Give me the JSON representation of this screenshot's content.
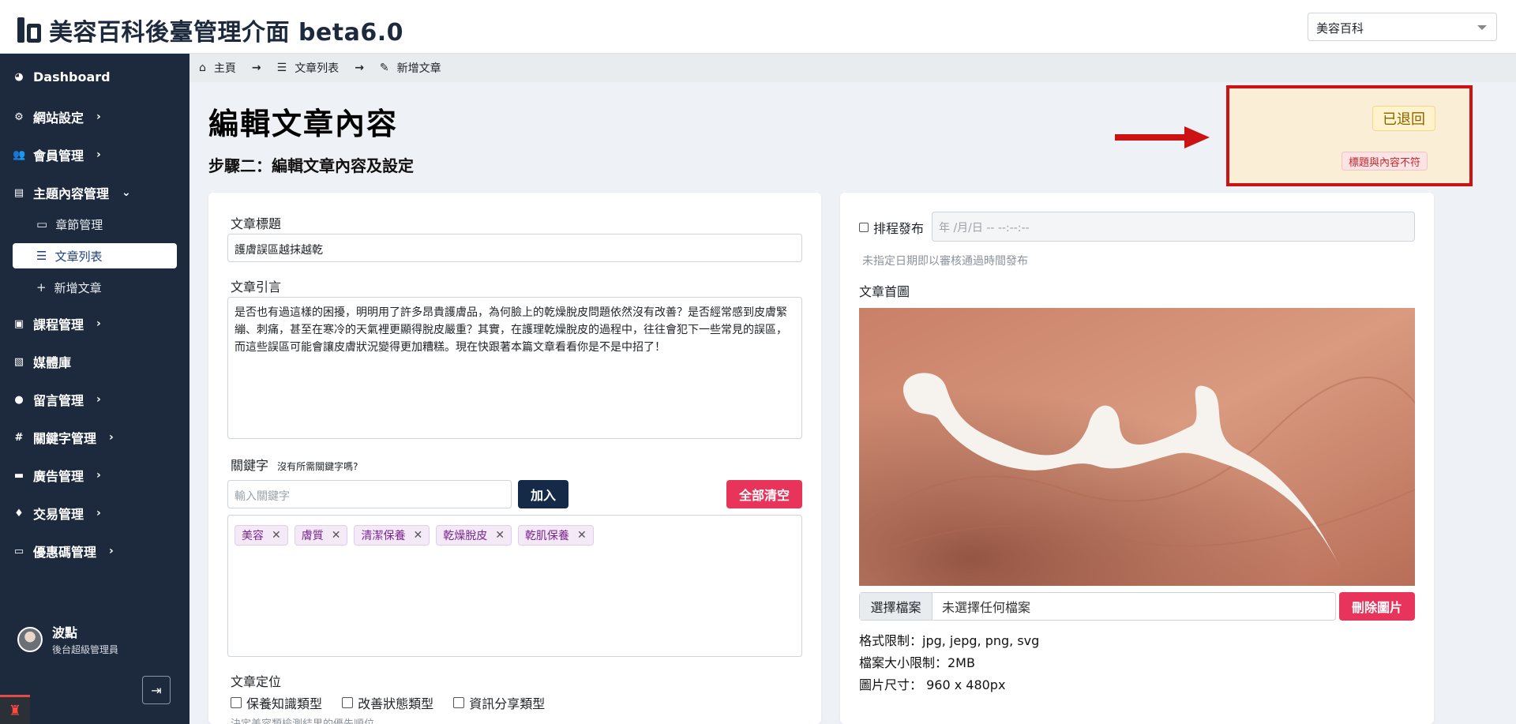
{
  "header": {
    "app_title": "美容百科後臺管理介面 beta6.0",
    "site_selector_value": "美容百科"
  },
  "sidebar": {
    "items": [
      {
        "label": "Dashboard"
      },
      {
        "label": "網站設定"
      },
      {
        "label": "會員管理"
      },
      {
        "label": "主題內容管理"
      },
      {
        "label": "課程管理"
      },
      {
        "label": "媒體庫"
      },
      {
        "label": "留言管理"
      },
      {
        "label": "關鍵字管理"
      },
      {
        "label": "廣告管理"
      },
      {
        "label": "交易管理"
      },
      {
        "label": "優惠碼管理"
      }
    ],
    "sub_items": [
      {
        "label": "章節管理"
      },
      {
        "label": "文章列表"
      },
      {
        "label": "新增文章"
      }
    ],
    "user": {
      "name": "波點",
      "role": "後台超級管理員"
    }
  },
  "breadcrumb": {
    "home": "主頁",
    "list": "文章列表",
    "current": "新增文章"
  },
  "page": {
    "title": "編輯文章內容",
    "subtitle": "步驟二：編輯文章內容及設定"
  },
  "status": {
    "badge": "已退回",
    "reason": "標題與內容不符"
  },
  "form": {
    "title_label": "文章標題",
    "title_value": "護膚誤區越抹越乾",
    "excerpt_label": "文章引言",
    "excerpt_value": "是否也有過這樣的困擾，明明用了許多昂貴護膚品，為何臉上的乾燥脫皮問題依然沒有改善？是否經常感到皮膚緊繃、刺痛，甚至在寒冷的天氣裡更顯得脫皮嚴重？其實，在護理乾燥脫皮的過程中，往往會犯下一些常見的誤區，而這些誤區可能會讓皮膚狀況變得更加糟糕。現在快跟著本篇文章看看你是不是中招了！",
    "keyword_label": "關鍵字",
    "keyword_hint": "沒有所需關鍵字嗎?",
    "keyword_placeholder": "輸入關鍵字",
    "add_button": "加入",
    "clear_button": "全部清空",
    "tags": [
      "美容",
      "膚質",
      "清潔保養",
      "乾燥脫皮",
      "乾肌保養"
    ],
    "position_label": "文章定位",
    "position_options": [
      "保養知識類型",
      "改善狀態類型",
      "資訊分享類型"
    ],
    "position_hint": "決定美容類檢測結果的優先順位"
  },
  "right": {
    "schedule_label": "排程發布",
    "datetime_placeholder": "年 /月/日 -- --:--:--",
    "schedule_hint": "未指定日期即以審核通過時間發布",
    "cover_label": "文章首圖",
    "choose_file": "選擇檔案",
    "no_file": "未選擇任何檔案",
    "delete_image": "刪除圖片",
    "spec_format": "格式限制：jpg, jepg, png, svg",
    "spec_size": "檔案大小限制：2MB",
    "spec_dimension": "圖片尺寸： 960 x 480px"
  },
  "icons": {
    "dashboard": "palette-icon",
    "settings": "gear-icon",
    "members": "users-icon",
    "content": "folder-icon",
    "logout": "sign-out-icon"
  },
  "colors": {
    "sidebar_bg": "#1d2a3d",
    "primary_dark": "#142a48",
    "danger": "#e8345b",
    "annotation_red": "#cc1212"
  }
}
